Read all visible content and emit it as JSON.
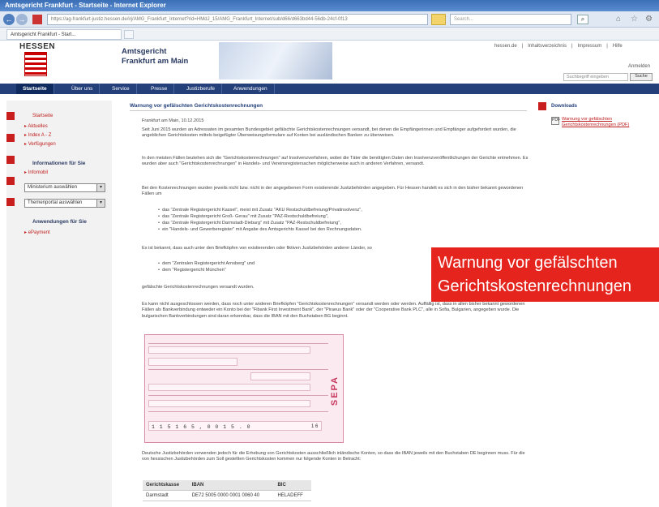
{
  "browser": {
    "title": "Amtsgericht Frankfurt - Startseite - Internet Explorer",
    "url": "https://ag-frankfurt-justiz.hessen.de/irj/AMG_Frankfurt_Internet?rid=HMdJ_15/AMG_Frankfurt_Internet/sub/d66/d663bd44-56db-24cf-0f13",
    "search_placeholder": "Search...",
    "tab_label": "Amtsgericht Frankfurt - Start..."
  },
  "header": {
    "state": "HESSEN",
    "court_line1": "Amtsgericht",
    "court_line2": "Frankfurt am Main",
    "links": [
      "hessen.de",
      "|",
      "Inhaltsverzeichnis",
      "|",
      "Impressum",
      "|",
      "Hilfe"
    ],
    "login": "Anmelden",
    "search_placeholder": "Suchbegriff eingeben",
    "search_button": "Suche"
  },
  "nav": [
    "Startseite",
    "Über uns",
    "Service",
    "Presse",
    "Justizberufe",
    "Anwendungen"
  ],
  "sidebar": {
    "links": [
      "Startseite",
      "Aktuelles",
      "Index A - Z",
      "Verfügungen"
    ],
    "info_head": "Informationen für Sie",
    "info_link": "Infomobil",
    "select1": "Ministerium auswählen",
    "select2": "Themenportal auswählen",
    "apps_head": "Anwendungen für Sie",
    "apps_link": "ePayment"
  },
  "main": {
    "heading": "Warnung vor gefälschten Gerichtskostenrechnungen",
    "date": "Frankfurt am Main, 10.12.2015",
    "p1": "Seit Juni 2015 wurden an Adressaten im gesamten Bundesgebiet gefälschte Gerichtskostenrechnungen versandt, bei denen die Empfängerinnen und Empfänger aufgefordert wurden, die angeblichen Gerichtskosten mittels beigefügter Überweisungsformulare auf Konten bei ausländischen Banken zu überweisen.",
    "p2": "In den meisten Fällen beziehen sich die \"Gerichtskostenrechnungen\" auf Insolvenzverfahren, wobei die Täter die benötigten Daten den Insolvenzveröffentlichungen der Gerichte entnehmen. Es wurden aber auch \"Gerichtskostenrechnungen\" in Handels- und Vereinsregistersachen möglicherweise auch in anderen Verfahren, versandt.",
    "p3": "Bei den Kostenrechnungen wurden jeweils nicht bzw. nicht in der angegebenen Form existierende Justizbehörden angegeben. Für Hessen handelt es sich in den bisher bekannt gewordenen Fällen um",
    "bullets1": [
      "das \"Zentrale Registergericht Kassel\", meist mit Zusatz \"AKU Restschuldbefreiung/Privatinsolvenz\",",
      "das \"Zentrale Registergericht Groß- Gerau\" mit Zusatz \"PAZ-Restschuldbefreiung\",",
      "das \"Zentrale Registergericht Darmstadt-Dieburg\" mit Zusatz \"PAZ-Restschuldbefreiung\",",
      "ein \"Handels- und Gewerberegister\" mit Angabe des Amtsgerichts Kassel bei den Rechnungsdaten."
    ],
    "p4": "Es ist bekannt, dass auch unter den Briefköpfen von existierenden oder fiktiven Justizbehörden anderer Länder, so",
    "bullets2": [
      "dem \"Zentralen Registergericht Arnsberg\" und",
      "dem \"Registergericht München\""
    ],
    "p5": "gefälschte Gerichtskostenrechnungen versandt wurden.",
    "p6": "Es kann nicht ausgeschlossen werden, dass noch unter anderen Briefköpfen \"Gerichtskostenrechnungen\" versandt werden oder werden. Auffällig ist, dass in allen bisher bekannt gewordenen Fällen als Bankverbindung entweder ein Konto bei der \"Fibank First Investment Bank\", der \"Piraeus Bank\" oder der \"Cooperative Bank PLC\", alle in Sofia, Bulgarien, angegeben wurde. Die bulgarischen Bankverbindungen sind daran erkennbar, dass die IBAN mit den Buchstaben BG beginnt.",
    "p7": "Deutsche Justizbehörden verwenden jedoch für die Erhebung von Gerichtskosten ausschließlich inländische Konten, so dass die IBAN jeweils mit den Buchstaben DE beginnen muss. Für die von hessischen Justizbehörden zum Soll gestellten Gerichtskosten kommen nur folgende Konten in Betracht:"
  },
  "form": {
    "sepa": "SEPA",
    "number": "1 1   5 1 6 5 , 0 0 1 5 . 0",
    "suffix": "1 6"
  },
  "table": {
    "headers": [
      "Gerichtskasse",
      "IBAN",
      "BIC"
    ],
    "row": [
      "Darmstadt",
      "DE72 5005 0000 0001 0060 40",
      "HELADEFF"
    ]
  },
  "right": {
    "label": "Downloads",
    "pdf_link": "Warnung vor gefälschten Gerichtskostenrechnungen (PDF)"
  },
  "overlay": {
    "line1": "Warnung vor gefälschten",
    "line2": "Gerichtskostenrechnungen"
  }
}
